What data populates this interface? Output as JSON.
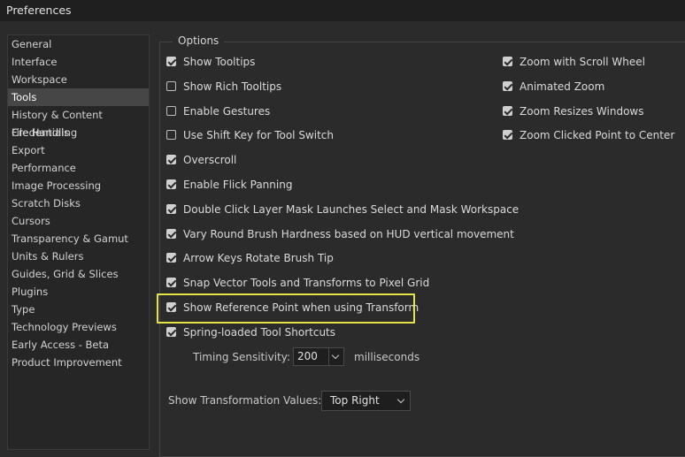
{
  "window": {
    "title": "Preferences"
  },
  "sidebar": {
    "selected_index": 3,
    "items": [
      "General",
      "Interface",
      "Workspace",
      "Tools",
      "History & Content Credentials",
      "File Handling",
      "Export",
      "Performance",
      "Image Processing",
      "Scratch Disks",
      "Cursors",
      "Transparency & Gamut",
      "Units & Rulers",
      "Guides, Grid & Slices",
      "Plugins",
      "Type",
      "Technology Previews",
      "Early Access - Beta",
      "Product Improvement"
    ]
  },
  "options": {
    "legend": "Options",
    "left_column": [
      {
        "label": "Show Tooltips",
        "checked": true
      },
      {
        "label": "Show Rich Tooltips",
        "checked": false
      },
      {
        "label": "Enable Gestures",
        "checked": false
      },
      {
        "label": "Use Shift Key for Tool Switch",
        "checked": false
      },
      {
        "label": "Overscroll",
        "checked": true
      },
      {
        "label": "Enable Flick Panning",
        "checked": true
      },
      {
        "label": "Double Click Layer Mask Launches Select and Mask Workspace",
        "checked": true
      },
      {
        "label": "Vary Round Brush Hardness based on HUD vertical movement",
        "checked": true
      },
      {
        "label": "Arrow Keys Rotate Brush Tip",
        "checked": true
      },
      {
        "label": "Snap Vector Tools and Transforms to Pixel Grid",
        "checked": true
      },
      {
        "label": "Show Reference Point when using Transform",
        "checked": true
      },
      {
        "label": "Spring-loaded Tool Shortcuts",
        "checked": true
      }
    ],
    "right_column": [
      {
        "label": "Zoom with Scroll Wheel",
        "checked": true
      },
      {
        "label": "Animated Zoom",
        "checked": true
      },
      {
        "label": "Zoom Resizes Windows",
        "checked": true
      },
      {
        "label": "Zoom Clicked Point to Center",
        "checked": true
      }
    ],
    "highlight_color": "#e6e445",
    "timing": {
      "label": "Timing Sensitivity:",
      "value": "200",
      "unit": "milliseconds"
    },
    "transformation": {
      "label": "Show Transformation Values:",
      "value": "Top Right"
    }
  }
}
